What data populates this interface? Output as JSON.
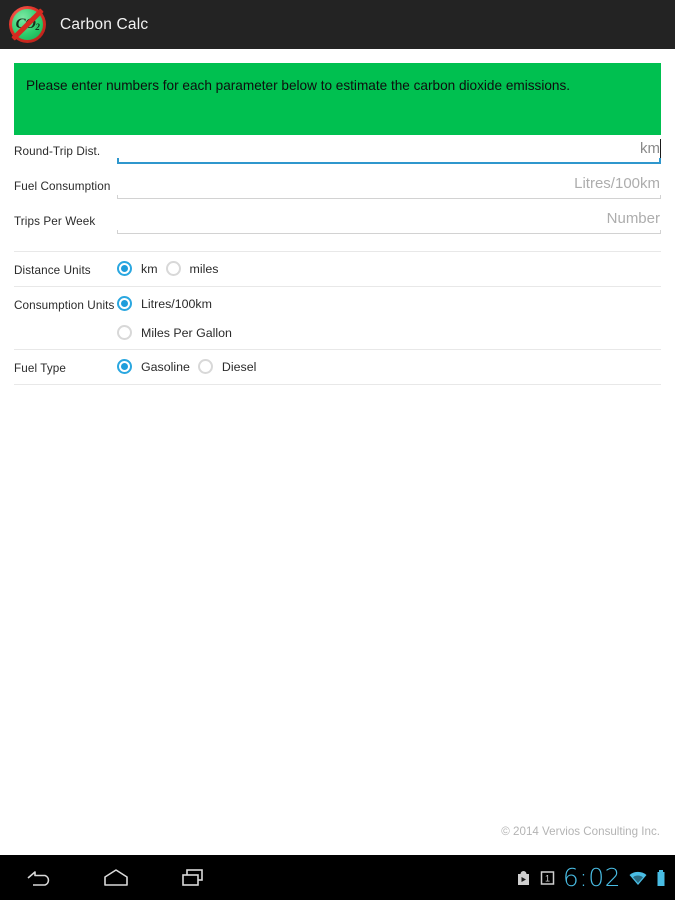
{
  "titlebar": {
    "app_name": "Carbon Calc",
    "icon_name": "co2-no-emission-icon",
    "icon_label_main": "CO",
    "icon_label_sub": "2",
    "background_color": "#232323"
  },
  "banner": {
    "text": "Please enter numbers for each parameter below to estimate the carbon dioxide emissions.",
    "background_color": "#00c050"
  },
  "form": {
    "fields": [
      {
        "label": "Round-Trip Dist.",
        "value": "",
        "placeholder": "km",
        "focused": true
      },
      {
        "label": "Fuel Consumption",
        "value": "",
        "placeholder": "Litres/100km",
        "focused": false
      },
      {
        "label": "Trips Per Week",
        "value": "",
        "placeholder": "Number",
        "focused": false
      }
    ],
    "radio_groups": [
      {
        "label": "Distance Units",
        "layout": "inline",
        "options": [
          {
            "label": "km",
            "selected": true
          },
          {
            "label": "miles",
            "selected": false
          }
        ]
      },
      {
        "label": "Consumption Units",
        "layout": "stacked",
        "options": [
          {
            "label": "Litres/100km",
            "selected": true
          },
          {
            "label": "Miles Per Gallon",
            "selected": false
          }
        ]
      },
      {
        "label": "Fuel Type",
        "layout": "inline",
        "options": [
          {
            "label": "Gasoline",
            "selected": true
          },
          {
            "label": "Diesel",
            "selected": false
          }
        ]
      }
    ]
  },
  "footer": {
    "copyright": "© 2014 Vervios Consulting Inc."
  },
  "navbar": {
    "buttons": [
      {
        "name": "back-icon"
      },
      {
        "name": "home-icon"
      },
      {
        "name": "recents-icon"
      }
    ],
    "tray": {
      "play-store-icon": "play-store-icon",
      "calendar-icon": "calendar-icon",
      "calendar_day": "1",
      "clock": "6:02",
      "wifi-icon": "wifi-icon",
      "battery-icon": "battery-icon",
      "accent_color": "#49bde4"
    }
  }
}
